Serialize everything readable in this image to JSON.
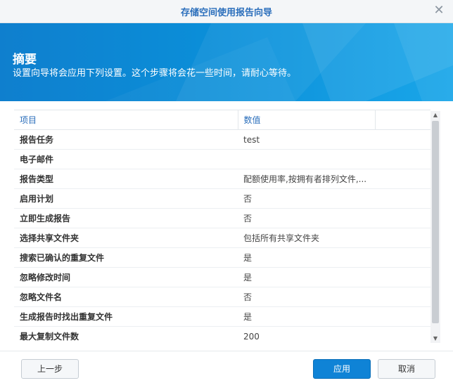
{
  "window": {
    "title": "存储空间使用报告向导"
  },
  "banner": {
    "title": "摘要",
    "subtitle": "设置向导将会应用下列设置。这个步骤将会花一些时间，请耐心等待。"
  },
  "table": {
    "headers": [
      "项目",
      "数值"
    ],
    "rows": [
      {
        "key": "报告任务",
        "value": "test"
      },
      {
        "key": "电子邮件",
        "value": ""
      },
      {
        "key": "报告类型",
        "value": "配额使用率,按拥有者排列文件,..."
      },
      {
        "key": "启用计划",
        "value": "否"
      },
      {
        "key": "立即生成报告",
        "value": "否"
      },
      {
        "key": "选择共享文件夹",
        "value": "包括所有共享文件夹"
      },
      {
        "key": "搜索已确认的重复文件",
        "value": "是"
      },
      {
        "key": "忽略修改时间",
        "value": "是"
      },
      {
        "key": "忽略文件名",
        "value": "否"
      },
      {
        "key": "生成报告时找出重复文件",
        "value": "是"
      },
      {
        "key": "最大复制文件数",
        "value": "200"
      }
    ]
  },
  "buttons": {
    "back": "上一步",
    "apply": "应用",
    "cancel": "取消"
  },
  "icons": {
    "close": "close-icon"
  },
  "colors": {
    "accent": "#2a6ebb",
    "banner": "#0f83d6"
  }
}
